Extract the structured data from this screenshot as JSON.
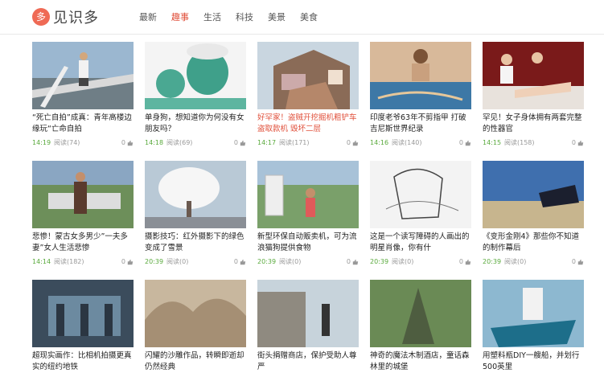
{
  "brand": {
    "logo_char": "多",
    "name": "见识多"
  },
  "nav": [
    {
      "label": "最新",
      "active": false
    },
    {
      "label": "趣事",
      "active": true
    },
    {
      "label": "生活",
      "active": false
    },
    {
      "label": "科技",
      "active": false
    },
    {
      "label": "美景",
      "active": false
    },
    {
      "label": "美食",
      "active": false
    }
  ],
  "articles": [
    {
      "title": "“死亡自拍”成真：青年高楼边缘玩“亡命自拍",
      "time": "14:19",
      "views": "阅读(74)",
      "likes": "0",
      "red": false
    },
    {
      "title": "单身狗，想知道你为何没有女朋友吗？",
      "time": "14:18",
      "views": "阅读(69)",
      "likes": "0",
      "red": false
    },
    {
      "title": "好罕家！盗贼开挖掘机粗铲车盗取款机 毁坏二层",
      "time": "14:17",
      "views": "阅读(171)",
      "likes": "0",
      "red": true
    },
    {
      "title": "印度老爷63年不剪指甲 打破吉尼斯世界纪录",
      "time": "14:16",
      "views": "阅读(140)",
      "likes": "0",
      "red": false
    },
    {
      "title": "罕见！女子身体拥有两套完整的性器官",
      "time": "14:15",
      "views": "阅读(158)",
      "likes": "0",
      "red": false
    },
    {
      "title": "悲惨！蒙古女多男少”一夫多妻”女人生活悲惨",
      "time": "14:14",
      "views": "阅读(182)",
      "likes": "0",
      "red": false
    },
    {
      "title": "摄影技巧：红外摄影下的绿色变成了雪景",
      "time": "20:39",
      "views": "阅读(0)",
      "likes": "0",
      "red": false
    },
    {
      "title": "新型环保自动贩卖机，可为流浪猫狗提供食物",
      "time": "20:39",
      "views": "阅读(0)",
      "likes": "0",
      "red": false
    },
    {
      "title": "这是一个读写障碍的人画出的明星肖像，你有什",
      "time": "20:39",
      "views": "阅读(0)",
      "likes": "0",
      "red": false
    },
    {
      "title": "《变形金刚4》那些你不知道的制作幕后",
      "time": "20:39",
      "views": "阅读(0)",
      "likes": "0",
      "red": false
    },
    {
      "title": "超现实画作：比相机拍摄更真实的纽约地铁",
      "time": "",
      "views": "",
      "likes": "",
      "red": false
    },
    {
      "title": "闪耀的沙雕作品，转瞬即逝却仍然经典",
      "time": "",
      "views": "",
      "likes": "",
      "red": false
    },
    {
      "title": "街头捐赠商店，保护受助人尊严",
      "time": "",
      "views": "",
      "likes": "",
      "red": false
    },
    {
      "title": "神奇的魔法木制酒店，童话森林里的城堡",
      "time": "",
      "views": "",
      "likes": "",
      "red": false
    },
    {
      "title": "用塑料瓶DIY一艘船，并划行500英里",
      "time": "",
      "views": "",
      "likes": "",
      "red": false
    }
  ],
  "colors": {
    "accent": "#e04f3a",
    "time": "#5aaa3d",
    "logo_bg": "#ef6a55"
  }
}
